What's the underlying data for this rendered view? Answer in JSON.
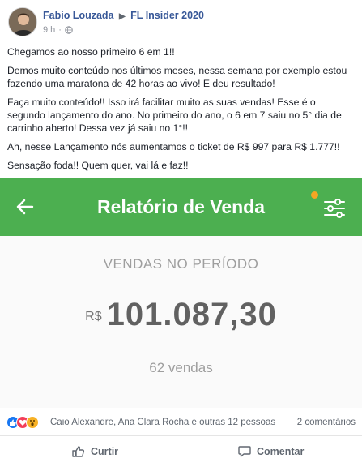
{
  "post": {
    "author": "Fabio Louzada",
    "group": "FL Insider 2020",
    "time": "9 h",
    "paragraphs": [
      "Chegamos ao nosso primeiro 6 em 1!!",
      "Demos muito conteúdo nos últimos meses, nessa semana por exemplo estou fazendo uma maratona de 42 horas ao vivo! E deu resultado!",
      "Faça muito conteúdo!! Isso irá facilitar muito as suas vendas! Esse é o segundo lançamento do ano. No primeiro do ano, o 6 em 7 saiu no 5° dia de carrinho aberto! Dessa vez já saiu no 1°!!",
      "Ah, nesse Lançamento nós aumentamos o ticket de R$ 997 para R$ 1.777!!",
      "Sensação foda!! Quem quer, vai lá e faz!!"
    ]
  },
  "app": {
    "title": "Relatório de Venda",
    "period_label": "VENDAS NO PERÍODO",
    "currency": "R$",
    "amount": "101.087,30",
    "sales_count": "62 vendas",
    "accent_color": "#4caf50"
  },
  "engagement": {
    "reaction_names": "Caio Alexandre, Ana Clara Rocha e outras 12 pessoas",
    "comment_count": "2 comentários"
  },
  "actions": {
    "like": "Curtir",
    "comment": "Comentar"
  }
}
